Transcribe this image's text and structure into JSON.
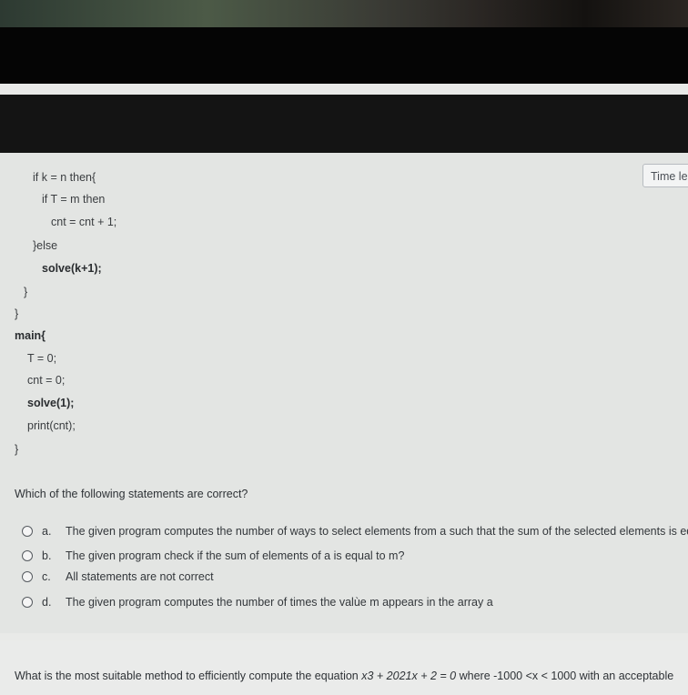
{
  "timer": {
    "label": "Time le"
  },
  "code": {
    "lines": [
      "if k = n then{",
      "if T = m then",
      "cnt = cnt + 1;",
      "}else",
      "solve(k+1);",
      "}",
      "}",
      "main{",
      "T = 0;",
      "cnt = 0;",
      "solve(1);",
      "print(cnt);",
      "}"
    ]
  },
  "question": {
    "text": "Which of the following statements are correct?",
    "options": [
      {
        "letter": "a.",
        "text": "The given program computes the number of ways to select elements from a such that the sum of the selected elements is equa"
      },
      {
        "letter": "b.",
        "text": "The given program check if the sum of elements of a is equal to m?"
      },
      {
        "letter": "c.",
        "text": "All statements are not correct"
      },
      {
        "letter": "d.",
        "text": "The given program computes the number of times the valùe m appears in the array a"
      }
    ]
  },
  "next_question": {
    "prefix": "What is the most suitable method to efficiently compute the equation ",
    "equation": "x3 + 2021x + 2 = 0",
    "suffix": " where -1000 <x < 1000 with an acceptable"
  }
}
